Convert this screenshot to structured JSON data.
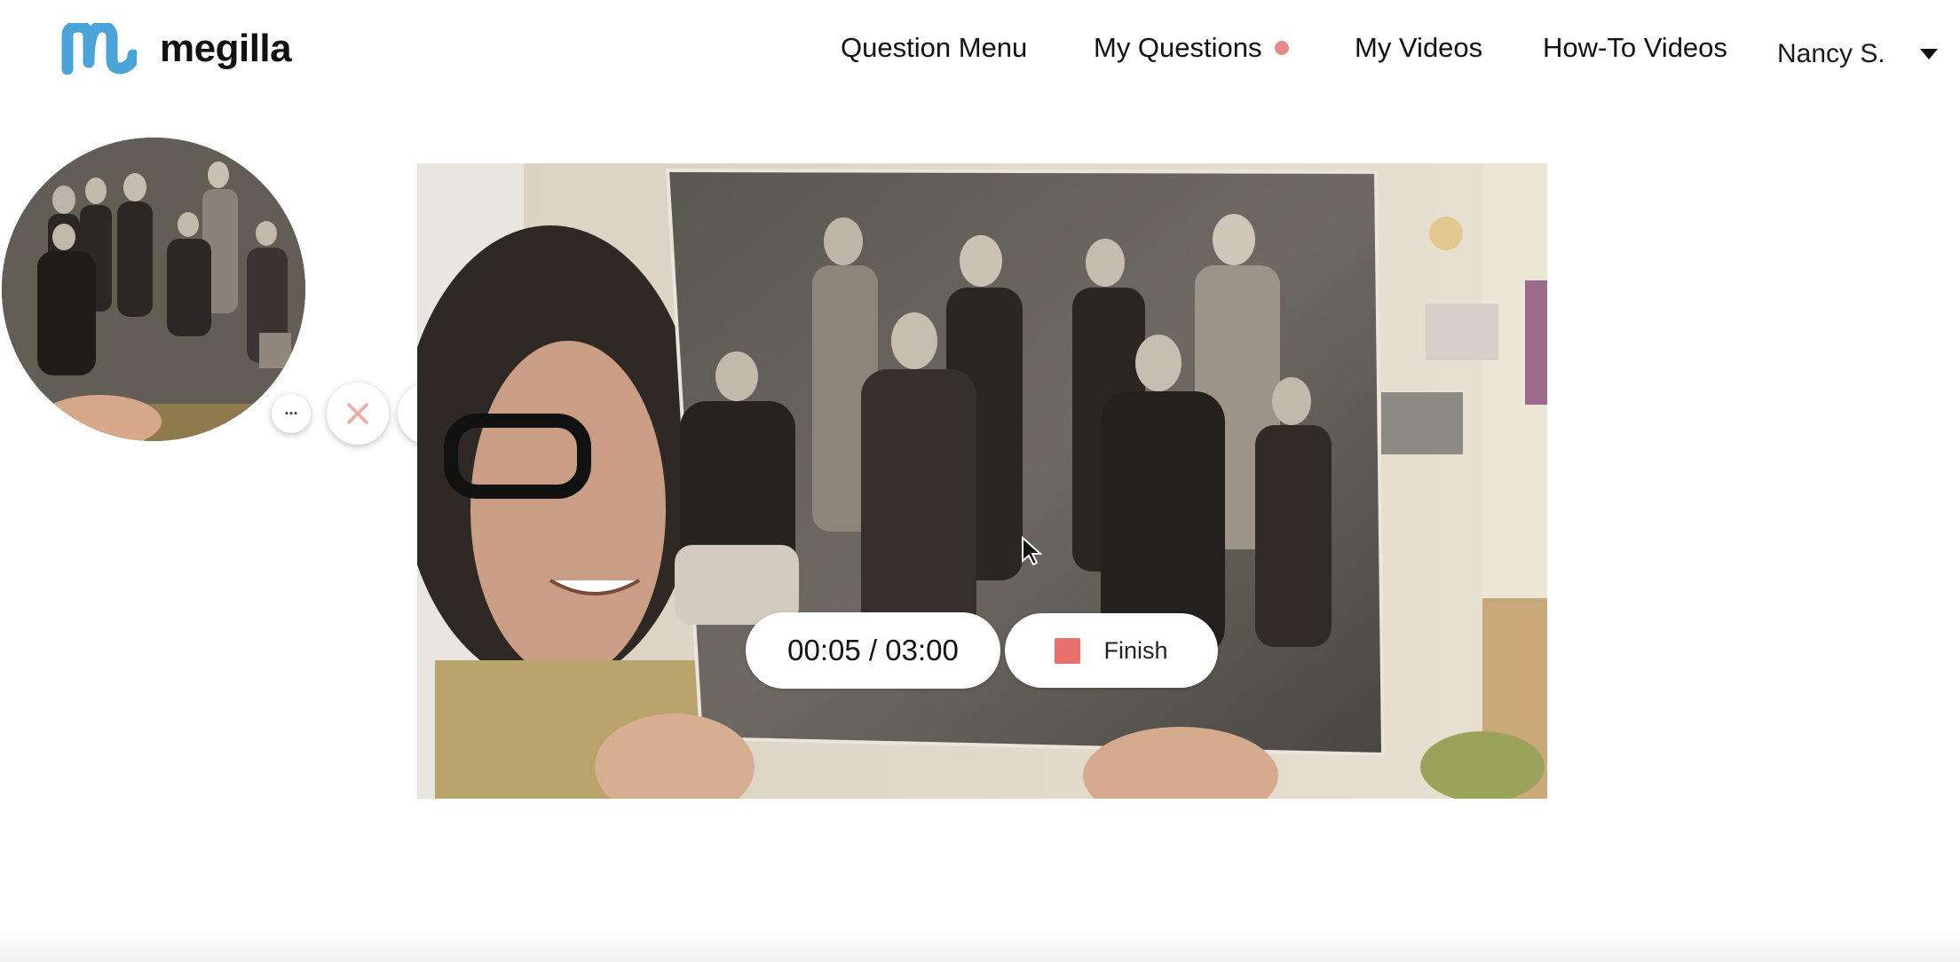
{
  "brand": {
    "name": "megilla",
    "logo_color": "#4aa3d9"
  },
  "nav": {
    "items": [
      {
        "label": "Question Menu"
      },
      {
        "label": "My Questions",
        "has_dot": true,
        "dot_color": "#e58a8a"
      },
      {
        "label": "My Videos"
      },
      {
        "label": "How-To Videos"
      }
    ],
    "user": {
      "name": "Nancy S."
    }
  },
  "recording": {
    "timer_text": "00:05 / 03:00",
    "elapsed_seconds": 5,
    "limit_seconds": 180,
    "finish_label": "Finish",
    "finish_color": "#e8706a"
  },
  "controls": {
    "more_label": "···",
    "icons": [
      "more-icon",
      "close-icon",
      "pause-icon",
      "check-icon"
    ],
    "confirm_color": "#5cc28a",
    "cancel_color": "#f0a9a0"
  }
}
